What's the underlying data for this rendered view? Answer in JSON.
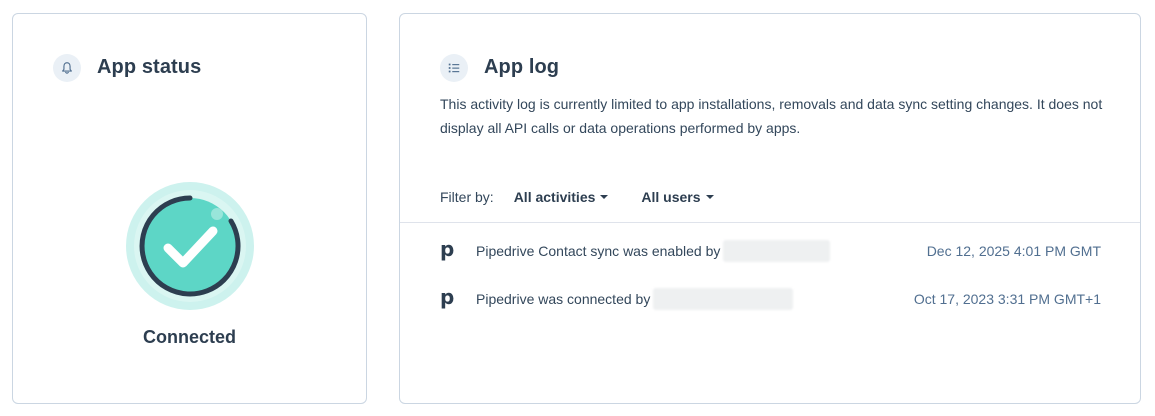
{
  "status_card": {
    "title": "App status",
    "icon": "bell-icon",
    "status_label": "Connected",
    "status_icon": "check-circle-icon",
    "colors": {
      "ring": "#cdf2ee",
      "fill": "#5dd6c6",
      "outline": "#2d3e50",
      "check": "#ffffff"
    }
  },
  "log_card": {
    "title": "App log",
    "icon": "list-icon",
    "description": "This activity log is currently limited to app installations, removals and data sync setting changes. It does not display all API calls or data operations performed by apps.",
    "filter": {
      "label": "Filter by:",
      "activities": "All activities",
      "users": "All users"
    },
    "entries": [
      {
        "app_icon": "pipedrive-logo-icon",
        "logo_glyph": "p",
        "text": "Pipedrive Contact sync was enabled by",
        "timestamp": "Dec 12, 2025 4:01 PM GMT"
      },
      {
        "app_icon": "pipedrive-logo-icon",
        "logo_glyph": "p",
        "text": "Pipedrive was connected by",
        "timestamp": "Oct 17, 2023 3:31 PM GMT+1"
      }
    ]
  }
}
